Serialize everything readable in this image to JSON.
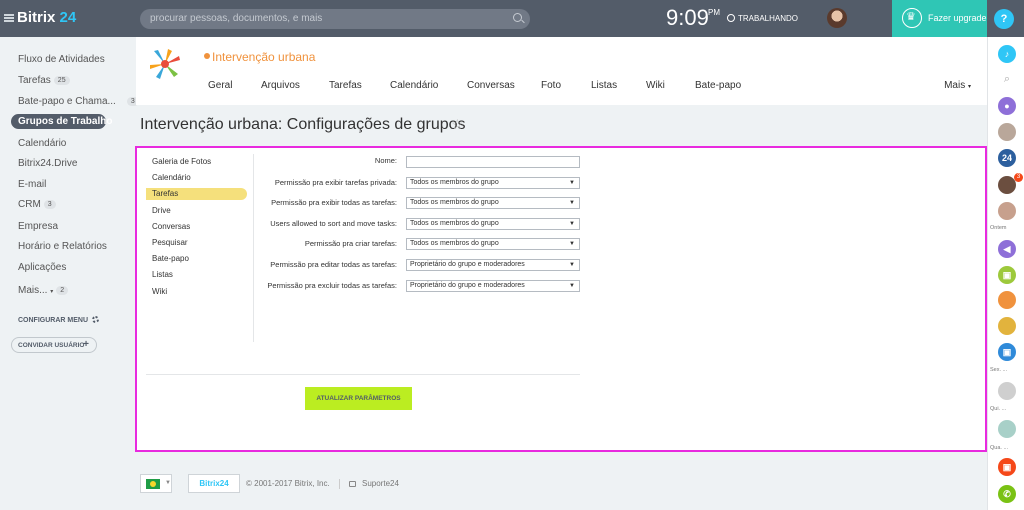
{
  "topbar": {
    "logo_text": "Bitrix",
    "logo_num": "24",
    "search_placeholder": "procurar pessoas, documentos, e mais",
    "time": "9:09",
    "ampm": "PM",
    "work_status": "TRABALHANDO",
    "upgrade_label": "Fazer upgrade",
    "help_label": "?"
  },
  "leftmenu": {
    "items": [
      {
        "label": "Fluxo de Atividades"
      },
      {
        "label": "Tarefas",
        "count": "25"
      },
      {
        "label": "Bate-papo e Chama...",
        "count": "3"
      },
      {
        "label": "Grupos de Trabalho"
      },
      {
        "label": "Calendário"
      },
      {
        "label": "Bitrix24.Drive"
      },
      {
        "label": "E-mail"
      },
      {
        "label": "CRM",
        "count": "3"
      },
      {
        "label": "Empresa"
      },
      {
        "label": "Horário e Relatórios"
      },
      {
        "label": "Aplicações"
      },
      {
        "label": "Mais...",
        "count": "2"
      }
    ],
    "configure": "CONFIGURAR MENU",
    "invite": "CONVIDAR USUÁRIO"
  },
  "group": {
    "name": "Intervenção urbana",
    "tabs": [
      "Geral",
      "Arquivos",
      "Tarefas",
      "Calendário",
      "Conversas",
      "Foto",
      "Listas",
      "Wiki",
      "Bate-papo"
    ],
    "more": "Mais"
  },
  "page_title": "Intervenção urbana: Configurações de grupos",
  "settings": {
    "side_items": [
      "Galeria de Fotos",
      "Calendário",
      "Tarefas",
      "Drive",
      "Conversas",
      "Pesquisar",
      "Bate-papo",
      "Listas",
      "Wiki"
    ],
    "active_side": "Tarefas",
    "fields": [
      {
        "label": "Nome:",
        "value": ""
      },
      {
        "label": "Permissão pra exibir tarefas privada:",
        "value": "Todos os membros do grupo"
      },
      {
        "label": "Permissão pra exibir todas as tarefas:",
        "value": "Todos os membros do grupo"
      },
      {
        "label": "Users allowed to sort and move tasks:",
        "value": "Todos os membros do grupo"
      },
      {
        "label": "Permissão pra criar tarefas:",
        "value": "Todos os membros do grupo"
      },
      {
        "label": "Permissão pra editar todas as tarefas:",
        "value": "Proprietário do grupo e moderadores"
      },
      {
        "label": "Permissão pra excluir todas as tarefas:",
        "value": "Proprietário do grupo e moderadores"
      }
    ],
    "save_label": "ATUALIZAR PARÂMETROS"
  },
  "footer": {
    "badge": "Bitrix24",
    "copyright": "© 2001-2017 Bitrix, Inc.",
    "support": "Suporte24"
  },
  "rightbar": {
    "labels": [
      "Ontem",
      "Sex. ...",
      "Qui. ...",
      "Qua. ..."
    ],
    "badge_count": "3"
  },
  "colors": {
    "topbar": "#535c69",
    "accent": "#2fc6f6",
    "upgrade": "#2fc6b5",
    "highlight_border": "#e82adf",
    "save_button": "#bbed21",
    "group_name": "#f0923d"
  }
}
